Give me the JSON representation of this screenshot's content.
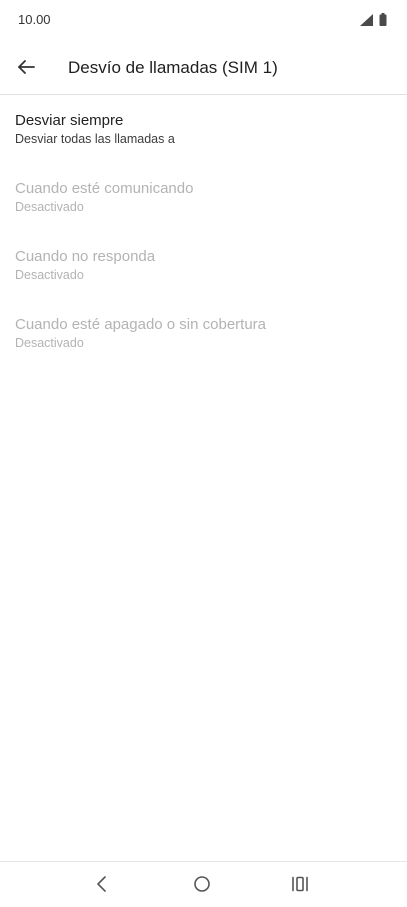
{
  "status_bar": {
    "time": "10.00",
    "icons": [
      "signal-icon",
      "battery-icon"
    ]
  },
  "toolbar": {
    "back_icon": "arrow-left-icon",
    "title": "Desvío de llamadas (SIM 1)"
  },
  "items": [
    {
      "title": "Desviar siempre",
      "subtitle": "Desviar todas las llamadas a",
      "enabled": true
    },
    {
      "title": "Cuando esté comunicando",
      "subtitle": "Desactivado",
      "enabled": false
    },
    {
      "title": "Cuando no responda",
      "subtitle": "Desactivado",
      "enabled": false
    },
    {
      "title": "Cuando esté apagado o sin cobertura",
      "subtitle": "Desactivado",
      "enabled": false
    }
  ],
  "nav_bar": {
    "icons": [
      "nav-back-icon",
      "nav-home-icon",
      "nav-recents-icon"
    ]
  },
  "colors": {
    "text_primary": "#1f1f1f",
    "text_disabled": "#b3b3b3",
    "divider": "#e0e0e0",
    "background": "#ffffff"
  }
}
